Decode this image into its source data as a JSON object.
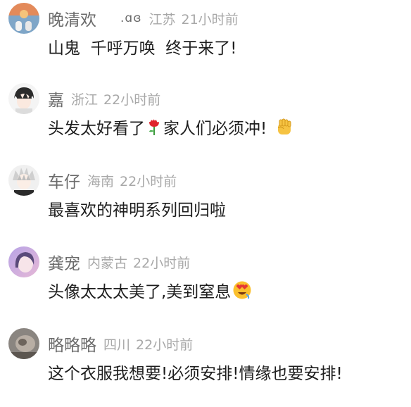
{
  "comments": [
    {
      "nickname": "晚清欢",
      "badge": ".ɑɞ",
      "location": "江苏",
      "time": "21小时前",
      "text": "山鬼  千呼万唤  终于来了!"
    },
    {
      "nickname": "嘉",
      "location": "浙江",
      "time": "22小时前",
      "text_before": "头发太好看了",
      "emoji1": "rose-emoji",
      "text_after": "家人们必须冲!",
      "emoji2": "raised-fist-emoji"
    },
    {
      "nickname": "车仔",
      "location": "海南",
      "time": "22小时前",
      "text": "最喜欢的神明系列回归啦"
    },
    {
      "nickname": "龚宠",
      "location": "内蒙古",
      "time": "22小时前",
      "text": "头像太太太美了,美到窒息",
      "emoji": "heart-eyes-emoji"
    },
    {
      "nickname": "略略略",
      "location": "四川",
      "time": "22小时前",
      "text": "这个衣服我想要!必须安排!情缘也要安排!"
    }
  ],
  "colors": {
    "nickname": "#6b6b6b",
    "meta": "#a8a8a8",
    "text": "#1e1e1e",
    "background": "#ffffff"
  }
}
